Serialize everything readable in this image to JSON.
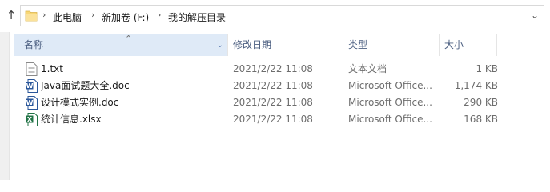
{
  "address": {
    "breadcrumb": [
      "此电脑",
      "新加卷 (F:)",
      "我的解压目录"
    ]
  },
  "columns": {
    "name": "名称",
    "modified": "修改日期",
    "type": "类型",
    "size": "大小"
  },
  "files": [
    {
      "name": "1.txt",
      "modified": "2021/2/22 11:08",
      "type": "文本文档",
      "size": "1 KB",
      "icon": "txt-file-icon"
    },
    {
      "name": "Java面试题大全.doc",
      "modified": "2021/2/22 11:08",
      "type": "Microsoft Office...",
      "size": "1,174 KB",
      "icon": "word-file-icon"
    },
    {
      "name": "设计模式实例.doc",
      "modified": "2021/2/22 11:08",
      "type": "Microsoft Office...",
      "size": "290 KB",
      "icon": "word-file-icon"
    },
    {
      "name": "统计信息.xlsx",
      "modified": "2021/2/22 11:08",
      "type": "Microsoft Office...",
      "size": "168 KB",
      "icon": "excel-file-icon"
    }
  ],
  "colors": {
    "header_text": "#4d6082",
    "sorted_header_bg": "#dfeaf7",
    "word_blue": "#2b579a",
    "excel_green": "#217346",
    "folder_yellow": "#f8d775"
  }
}
